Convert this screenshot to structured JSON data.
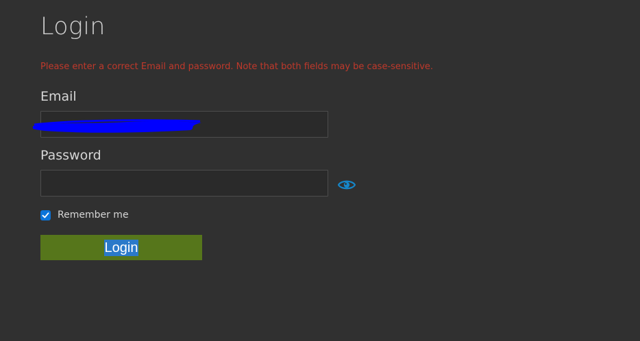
{
  "page": {
    "title": "Login",
    "error_message": "Please enter a correct Email and password. Note that both fields may be case-sensitive."
  },
  "form": {
    "email_label": "Email",
    "email_value": "",
    "password_label": "Password",
    "password_value": "",
    "remember_label": "Remember me",
    "remember_checked": true,
    "submit_label": "Login"
  },
  "icons": {
    "password_toggle": "eye-icon",
    "checkbox": "checkmark-icon"
  },
  "colors": {
    "background": "#303030",
    "error": "#c0392b",
    "button": "#56761b",
    "accent": "#0b74d9",
    "redaction": "#0000ff"
  }
}
